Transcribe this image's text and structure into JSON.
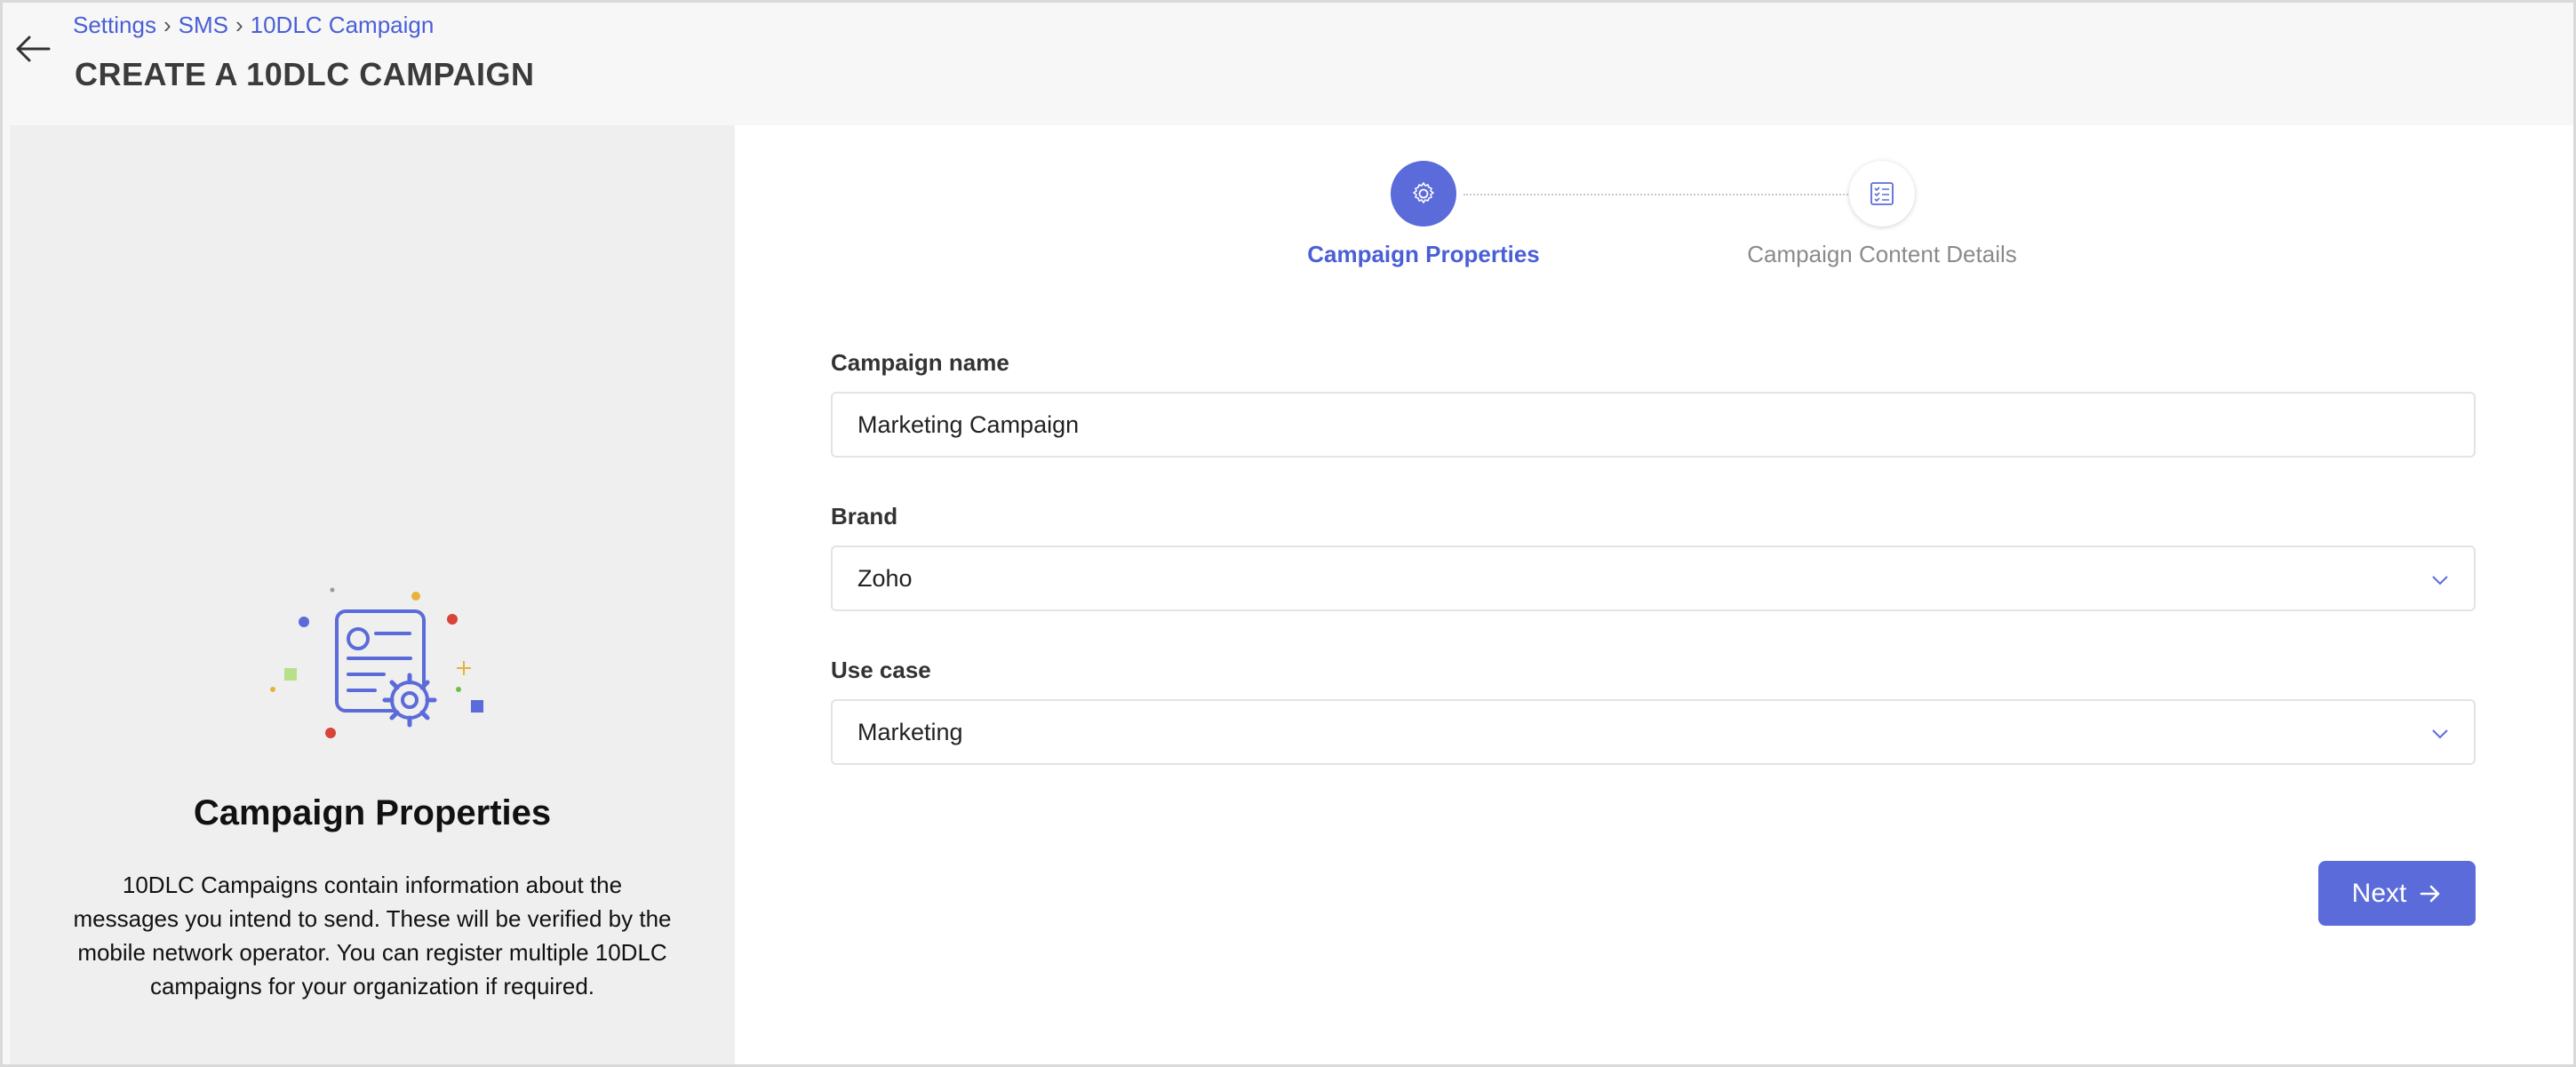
{
  "header": {
    "breadcrumb": [
      "Settings",
      "SMS",
      "10DLC Campaign"
    ],
    "title": "CREATE A 10DLC CAMPAIGN"
  },
  "icons": {
    "back": "arrow-left-icon",
    "step1": "gear-icon",
    "step2": "checklist-icon",
    "select": "chevron-down-icon",
    "next": "arrow-right-icon"
  },
  "left_panel": {
    "title": "Campaign Properties",
    "description": "10DLC Campaigns contain information about the messages you intend to send. These will be verified by the mobile network operator. You can register multiple 10DLC campaigns for your organization if required."
  },
  "stepper": {
    "steps": [
      {
        "label": "Campaign Properties",
        "active": true
      },
      {
        "label": "Campaign Content Details",
        "active": false
      }
    ]
  },
  "form": {
    "campaign_name": {
      "label": "Campaign name",
      "value": "Marketing Campaign"
    },
    "brand": {
      "label": "Brand",
      "value": "Zoho"
    },
    "use_case": {
      "label": "Use case",
      "value": "Marketing"
    }
  },
  "actions": {
    "next_label": "Next"
  },
  "colors": {
    "accent": "#5b6bd9",
    "link": "#4a5fd6",
    "panel_bg": "#efefef"
  }
}
